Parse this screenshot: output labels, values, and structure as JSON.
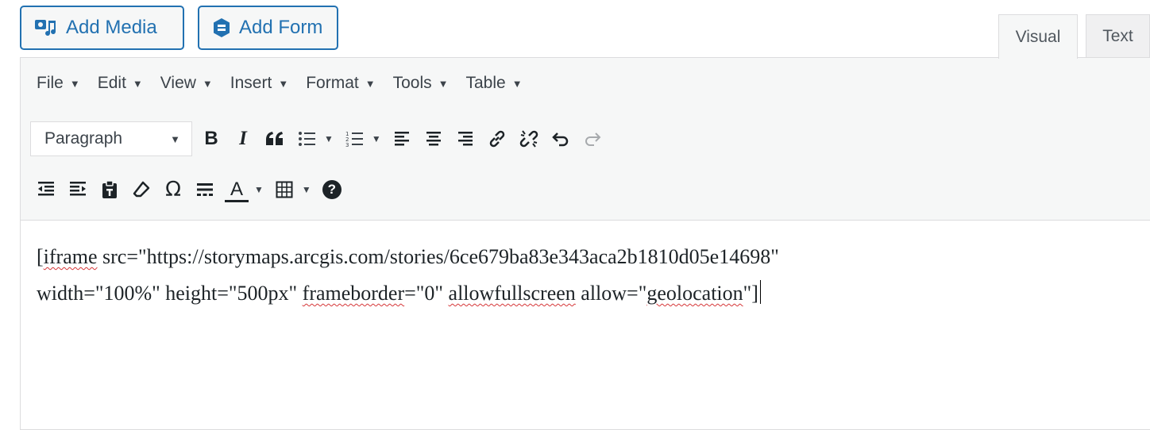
{
  "media_buttons": {
    "add_media": "Add Media",
    "add_form": "Add Form"
  },
  "tabs": {
    "visual": "Visual",
    "text": "Text"
  },
  "menubar": [
    "File",
    "Edit",
    "View",
    "Insert",
    "Format",
    "Tools",
    "Table"
  ],
  "toolbar": {
    "format_select": "Paragraph",
    "bold_label": "B",
    "italic_label": "I",
    "row1_icons": [
      "bold-icon",
      "italic-icon",
      "blockquote-icon",
      "bullet-list-icon",
      "numbered-list-icon",
      "align-left-icon",
      "align-center-icon",
      "align-right-icon",
      "link-icon",
      "unlink-icon",
      "undo-icon",
      "redo-icon"
    ],
    "row2_icons": [
      "outdent-icon",
      "indent-icon",
      "paste-text-icon",
      "clear-formatting-icon",
      "special-character-icon",
      "horizontal-line-icon",
      "text-color-icon",
      "table-icon",
      "help-icon"
    ],
    "omega_label": "Ω",
    "text_color_label": "A",
    "help_label": "?"
  },
  "content": {
    "line1": {
      "open": "[",
      "w_iframe": "iframe",
      "rest": " src=\"https://storymaps.arcgis.com/stories/6ce679ba83e343aca2b1810d05e14698\""
    },
    "line2": {
      "a": "width=\"100%\" height=\"500px\" ",
      "w_frameborder": "frameborder",
      "b": "=\"0\" ",
      "w_allowfullscreen": "allowfullscreen",
      "c": " allow=\"",
      "w_geolocation": "geolocation",
      "d": "\"]"
    }
  },
  "colors": {
    "accent": "#2271b1",
    "toolbar_bg": "#f6f7f7",
    "border": "#dcdcde",
    "spellcheck": "#d63638"
  }
}
